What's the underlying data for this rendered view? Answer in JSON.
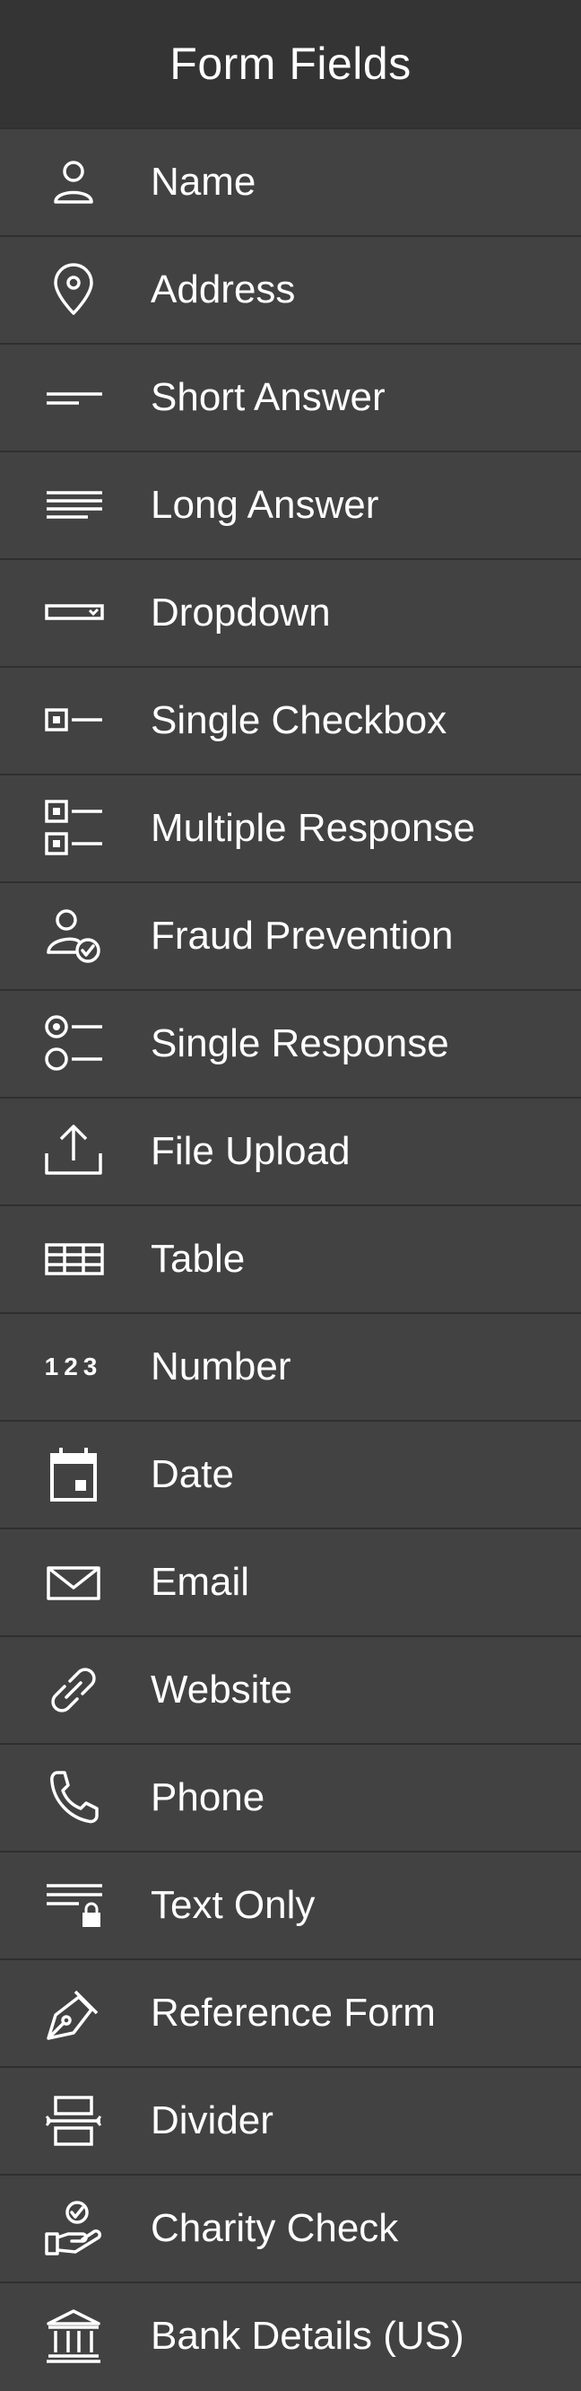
{
  "header": {
    "title": "Form Fields"
  },
  "items": [
    {
      "label": "Name",
      "icon": "person-icon"
    },
    {
      "label": "Address",
      "icon": "map-pin-icon"
    },
    {
      "label": "Short Answer",
      "icon": "short-lines-icon"
    },
    {
      "label": "Long Answer",
      "icon": "long-lines-icon"
    },
    {
      "label": "Dropdown",
      "icon": "dropdown-icon"
    },
    {
      "label": "Single Checkbox",
      "icon": "checkbox-icon"
    },
    {
      "label": "Multiple Response",
      "icon": "multi-checkbox-icon"
    },
    {
      "label": "Fraud Prevention",
      "icon": "person-check-icon"
    },
    {
      "label": "Single Response",
      "icon": "radio-icon"
    },
    {
      "label": "File Upload",
      "icon": "upload-icon"
    },
    {
      "label": "Table",
      "icon": "table-icon"
    },
    {
      "label": "Number",
      "icon": "number-icon",
      "glyph": "123"
    },
    {
      "label": "Date",
      "icon": "calendar-icon"
    },
    {
      "label": "Email",
      "icon": "envelope-icon"
    },
    {
      "label": "Website",
      "icon": "link-icon"
    },
    {
      "label": "Phone",
      "icon": "phone-icon"
    },
    {
      "label": "Text Only",
      "icon": "text-lock-icon"
    },
    {
      "label": "Reference Form",
      "icon": "pen-icon"
    },
    {
      "label": "Divider",
      "icon": "divider-icon"
    },
    {
      "label": "Charity Check",
      "icon": "hand-check-icon"
    },
    {
      "label": "Bank Details (US)",
      "icon": "bank-icon"
    }
  ],
  "colors": {
    "header_bg": "#343434",
    "item_bg": "#424242",
    "separator": "#2f2f2f",
    "text": "#ffffff"
  }
}
